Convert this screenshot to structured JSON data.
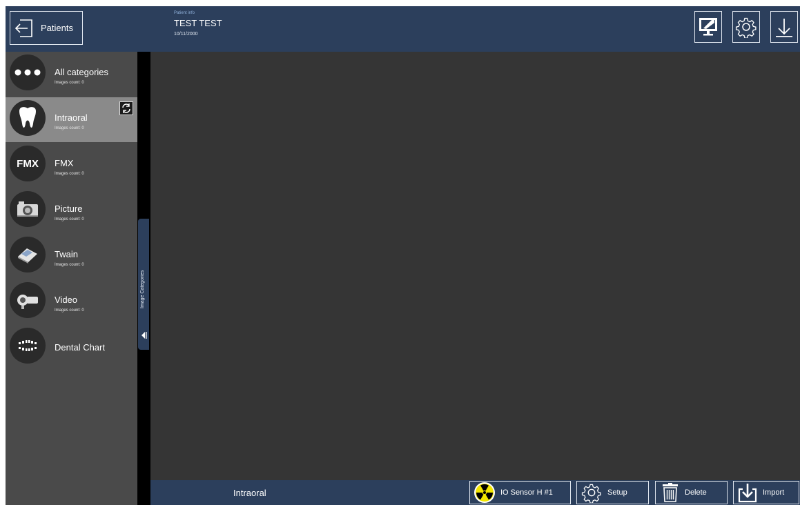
{
  "header": {
    "patients_label": "Patients",
    "patient_info_caption": "Patient info",
    "patient_name": "TEST TEST",
    "patient_date": "10/11/2000"
  },
  "categories": [
    {
      "label": "All categories",
      "count": "Images count: 0",
      "icon": "dots-icon"
    },
    {
      "label": "Intraoral",
      "count": "Images count: 0",
      "icon": "tooth-icon"
    },
    {
      "label": "FMX",
      "count": "Images count: 0",
      "icon": "fmx-icon",
      "icon_text": "FMX"
    },
    {
      "label": "Picture",
      "count": "Images count: 0",
      "icon": "camera-icon"
    },
    {
      "label": "Twain",
      "count": "Images count: 0",
      "icon": "scanner-icon"
    },
    {
      "label": "Video",
      "count": "Images count: 0",
      "icon": "video-camera-icon"
    },
    {
      "label": "Dental Chart",
      "icon": "dental-chart-icon"
    }
  ],
  "sidebar_tab_label": "Image Categories",
  "bottom_bar": {
    "current_category": "Intraoral",
    "sensor_label": "IO Sensor H #1",
    "setup_label": "Setup",
    "delete_label": "Delete",
    "import_label": "Import"
  },
  "colors": {
    "header_bg": "#2c3f5c",
    "sidebar_bg": "#4a4a4a",
    "active_item_bg": "#8a8a8a",
    "main_bg": "#353535",
    "radiation_yellow": "#f2e600"
  }
}
